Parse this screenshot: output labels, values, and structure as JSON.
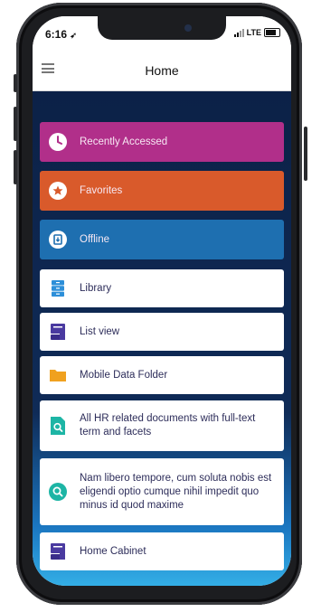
{
  "status_bar": {
    "time": "6:16",
    "network": "LTE"
  },
  "header": {
    "title": "Home"
  },
  "items": [
    {
      "label": "Recently Accessed",
      "icon": "clock-icon",
      "color": "#b12f8a"
    },
    {
      "label": "Favorites",
      "icon": "star-icon",
      "color": "#d95a2b"
    },
    {
      "label": "Offline",
      "icon": "offline-icon",
      "color": "#1e6fb0"
    },
    {
      "label": "Library",
      "icon": "library-icon",
      "color": "#ffffff"
    },
    {
      "label": "List view",
      "icon": "list-view-icon",
      "color": "#ffffff"
    },
    {
      "label": "Mobile Data Folder",
      "icon": "folder-icon",
      "color": "#ffffff"
    },
    {
      "label": "All HR related documents with full-text term and facets",
      "icon": "search-document-icon",
      "color": "#ffffff"
    },
    {
      "label": "Nam libero tempore, cum soluta nobis est eligendi optio cumque nihil impedit quo minus id quod maxime",
      "icon": "search-circle-icon",
      "color": "#ffffff"
    },
    {
      "label": "Home Cabinet",
      "icon": "cabinet-icon",
      "color": "#ffffff"
    }
  ],
  "colors": {
    "accent_blue": "#2d8fd9",
    "teal": "#1db5a5",
    "purple": "#4a3aa0",
    "amber": "#f0a11f"
  }
}
